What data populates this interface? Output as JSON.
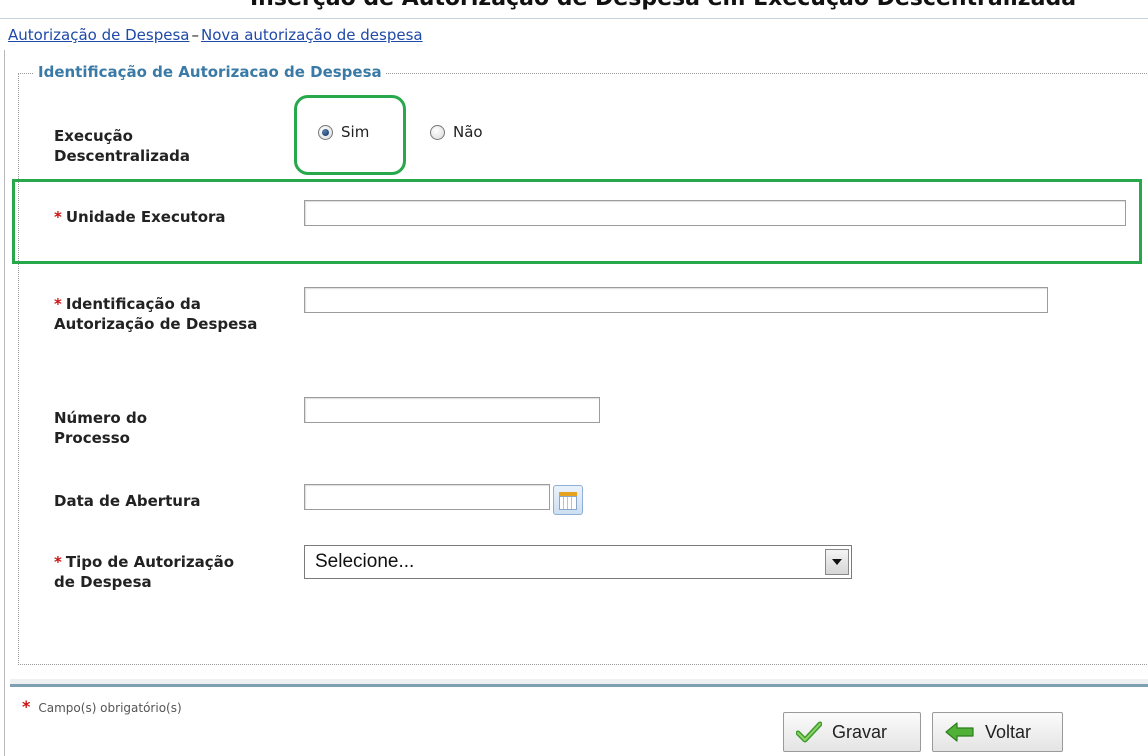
{
  "header": {
    "cut_title": "Inserção de Autorização de Despesa em Execução Descentralizada"
  },
  "breadcrumb": {
    "item1": "Autorização de Despesa",
    "separator": "–",
    "item2": "Nova autorização de despesa"
  },
  "fieldset": {
    "legend": "Identificação de Autorizacao de Despesa"
  },
  "form": {
    "execucao": {
      "label": "Execução Descentralizada",
      "options": [
        "Sim",
        "Não"
      ],
      "selected": "Sim"
    },
    "unidade": {
      "label": "Unidade Executora",
      "required": "*",
      "value": ""
    },
    "identificacao": {
      "label": "Identificação da Autorização de Despesa",
      "required": "*",
      "value": ""
    },
    "numero_processo": {
      "label": "Número do Processo",
      "value": ""
    },
    "data_abertura": {
      "label": "Data de Abertura",
      "value": ""
    },
    "tipo": {
      "label": "Tipo de Autorização de Despesa",
      "required": "*",
      "selected": "Selecione..."
    }
  },
  "footer": {
    "required_mark": "*",
    "required_note": "Campo(s) obrigatório(s)"
  },
  "buttons": {
    "gravar": "Gravar",
    "voltar": "Voltar"
  },
  "icons": {
    "calendar": "calendar-icon",
    "check": "check-icon",
    "back_arrow": "back-arrow-icon",
    "dropdown": "chevron-down-icon"
  },
  "colors": {
    "highlight": "#27a84a",
    "link": "#1f4aa8",
    "legend": "#3a7aa6",
    "required": "#cc1111"
  }
}
